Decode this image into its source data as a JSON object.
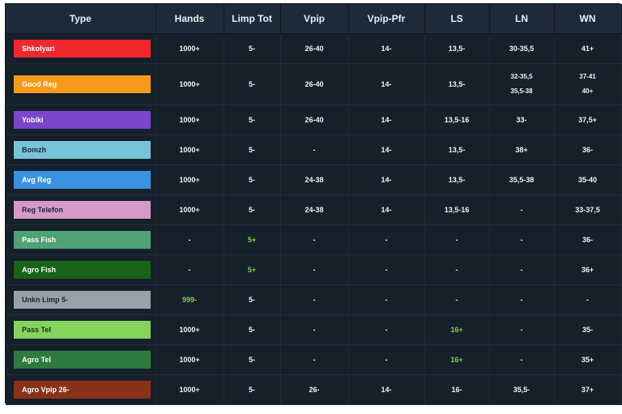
{
  "headers": [
    "Type",
    "Hands",
    "Limp Tot",
    "Vpip",
    "Vpip-Pfr",
    "LS",
    "LN",
    "WN"
  ],
  "colors": {
    "green_text": "#7fd447"
  },
  "rows": [
    {
      "type": "Shkolyari",
      "color": "#f0282e",
      "hands": "1000+",
      "limp": "5-",
      "vpip": "26-40",
      "vpfr": "14-",
      "ls": "13,5-",
      "ln": "30-35,5",
      "wn": "41+"
    },
    {
      "type": "Good Reg",
      "color": "#f79a1c",
      "hands": "1000+",
      "limp": "5-",
      "vpip": "26-40",
      "vpfr": "14-",
      "ls": "13,5-",
      "ln_1": "32-35,5",
      "ln_2": "35,5-38",
      "wn_1": "37-41",
      "wn_2": "40+"
    },
    {
      "type": "Yobiki",
      "color": "#7b46c9",
      "hands": "1000+",
      "limp": "5-",
      "vpip": "26-40",
      "vpfr": "14-",
      "ls": "13,5-16",
      "ln": "33-",
      "wn": "37,5+"
    },
    {
      "type": "Bomzh",
      "color": "#77c4da",
      "hands": "1000+",
      "limp": "5-",
      "vpip": "-",
      "vpfr": "14-",
      "ls": "13,5-",
      "ln": "38+",
      "wn": "36-"
    },
    {
      "type": "Avg Reg",
      "color": "#3b93e0",
      "hands": "1000+",
      "limp": "5-",
      "vpip": "24-38",
      "vpfr": "14-",
      "ls": "13,5-",
      "ln": "35,5-38",
      "wn": "35-40"
    },
    {
      "type": "Reg Telefon",
      "color": "#d69ac9",
      "hands": "1000+",
      "limp": "5-",
      "vpip": "24-38",
      "vpfr": "14-",
      "ls": "13,5-16",
      "ln": "-",
      "wn": "33-37,5"
    },
    {
      "type": "Pass Fish",
      "color": "#4fa273",
      "hands": "-",
      "limp": "5+",
      "vpip": "-",
      "vpfr": "-",
      "ls": "-",
      "ln": "-",
      "wn": "36-"
    },
    {
      "type": "Agro Fish",
      "color": "#176317",
      "hands": "-",
      "limp": "5+",
      "vpip": "-",
      "vpfr": "-",
      "ls": "-",
      "ln": "-",
      "wn": "36+"
    },
    {
      "type": "Unkn Limp 5-",
      "color": "#9aa0a8",
      "hands": "999-",
      "limp": "5-",
      "vpip": "-",
      "vpfr": "-",
      "ls": "-",
      "ln": "-",
      "wn": "-"
    },
    {
      "type": "Pass Tel",
      "color": "#86d45c",
      "hands": "1000+",
      "limp": "5-",
      "vpip": "-",
      "vpfr": "-",
      "ls": "16+",
      "ln": "-",
      "wn": "35-"
    },
    {
      "type": "Agro Tel",
      "color": "#2e7a40",
      "hands": "1000+",
      "limp": "5-",
      "vpip": "-",
      "vpfr": "-",
      "ls": "16+",
      "ln": "-",
      "wn": "35+"
    },
    {
      "type": "Agro Vpip 26-",
      "color": "#8a3217",
      "hands": "1000+",
      "limp": "5-",
      "vpip": "26-",
      "vpfr": "14-",
      "ls": "16-",
      "ln": "35,5-",
      "wn": "37+"
    }
  ]
}
